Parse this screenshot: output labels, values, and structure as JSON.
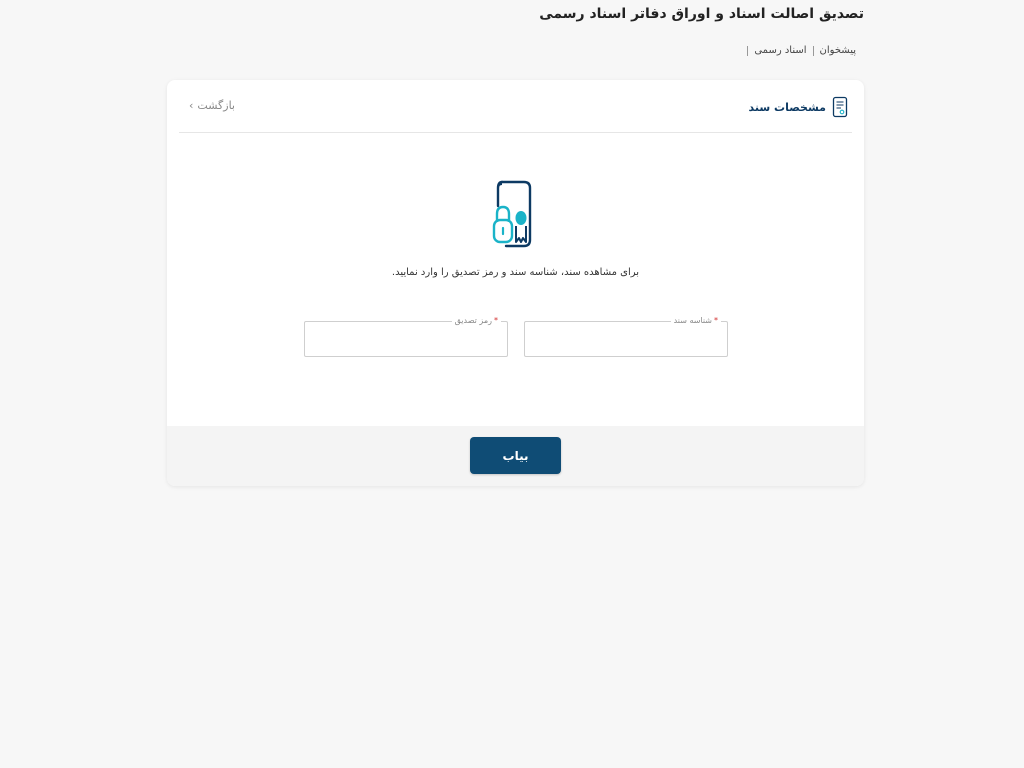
{
  "page": {
    "title": "تصدیق اصالت اسناد و اوراق دفاتر اسناد رسمی"
  },
  "breadcrumb": {
    "items": [
      "پیشخوان",
      "اسناد رسمی"
    ]
  },
  "card": {
    "header_title": "مشخصات سند",
    "header_icon": "document-icon",
    "back_label": "بازگشت",
    "back_icon": "chevron-right-icon",
    "hero_icon": "document-lock-seal-icon",
    "instruction": "برای مشاهده سند، شناسه سند و رمز تصدیق را وارد نمایید."
  },
  "form": {
    "doc_id": {
      "label": "شناسه سند",
      "required_mark": "*",
      "value": "",
      "placeholder": ""
    },
    "verify_code": {
      "label": "رمز تصدیق",
      "required_mark": "*",
      "value": "",
      "placeholder": ""
    },
    "submit_label": "بیاب"
  },
  "colors": {
    "primary": "#0f4c75",
    "accent": "#1ab3c8",
    "required": "#d32f2f",
    "background": "#f7f7f7"
  }
}
